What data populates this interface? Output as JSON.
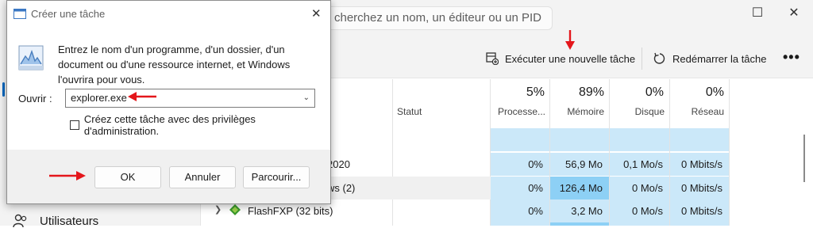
{
  "task_manager": {
    "search_placeholder": "cherchez un nom, un éditeur ou un PID",
    "toolbar": {
      "run_new_task": "Exécuter une nouvelle tâche",
      "restart_task": "Redémarrer la tâche",
      "more": "•••"
    },
    "sidebar": {
      "users_label": "Utilisateurs"
    },
    "columns": [
      {
        "pct": "5%",
        "label": "Processe..."
      },
      {
        "pct": "89%",
        "label": "Mémoire"
      },
      {
        "pct": "0%",
        "label": "Disque"
      },
      {
        "pct": "0%",
        "label": "Réseau"
      }
    ],
    "status_header": "Statut",
    "rows": [
      {
        "name": "2020",
        "cpu": "0%",
        "mem": "56,9 Mo",
        "disk": "0,1 Mo/s",
        "net": "0 Mbits/s"
      },
      {
        "name": "ws (2)",
        "cpu": "0%",
        "mem": "126,4 Mo",
        "disk": "0 Mo/s",
        "net": "0 Mbits/s"
      },
      {
        "name": "FlashFXP (32 bits)",
        "cpu": "0%",
        "mem": "3,2 Mo",
        "disk": "0 Mo/s",
        "net": "0 Mbits/s"
      }
    ],
    "colors": {
      "accent": "#0067c0",
      "heat_light": "#cbe8f9",
      "heat_strong": "#8dd0f5"
    }
  },
  "dialog": {
    "title": "Créer une tâche",
    "message": "Entrez le nom d'un programme, d'un dossier, d'un document ou d'une ressource internet, et Windows l'ouvrira pour vous.",
    "open_label": "Ouvrir :",
    "open_value": "explorer.exe",
    "admin_checkbox_label": "Créez cette tâche avec des privilèges d'administration.",
    "admin_checked": false,
    "buttons": {
      "ok": "OK",
      "cancel": "Annuler",
      "browse": "Parcourir..."
    }
  },
  "annotations": {
    "arrow_color": "#e4161b"
  }
}
